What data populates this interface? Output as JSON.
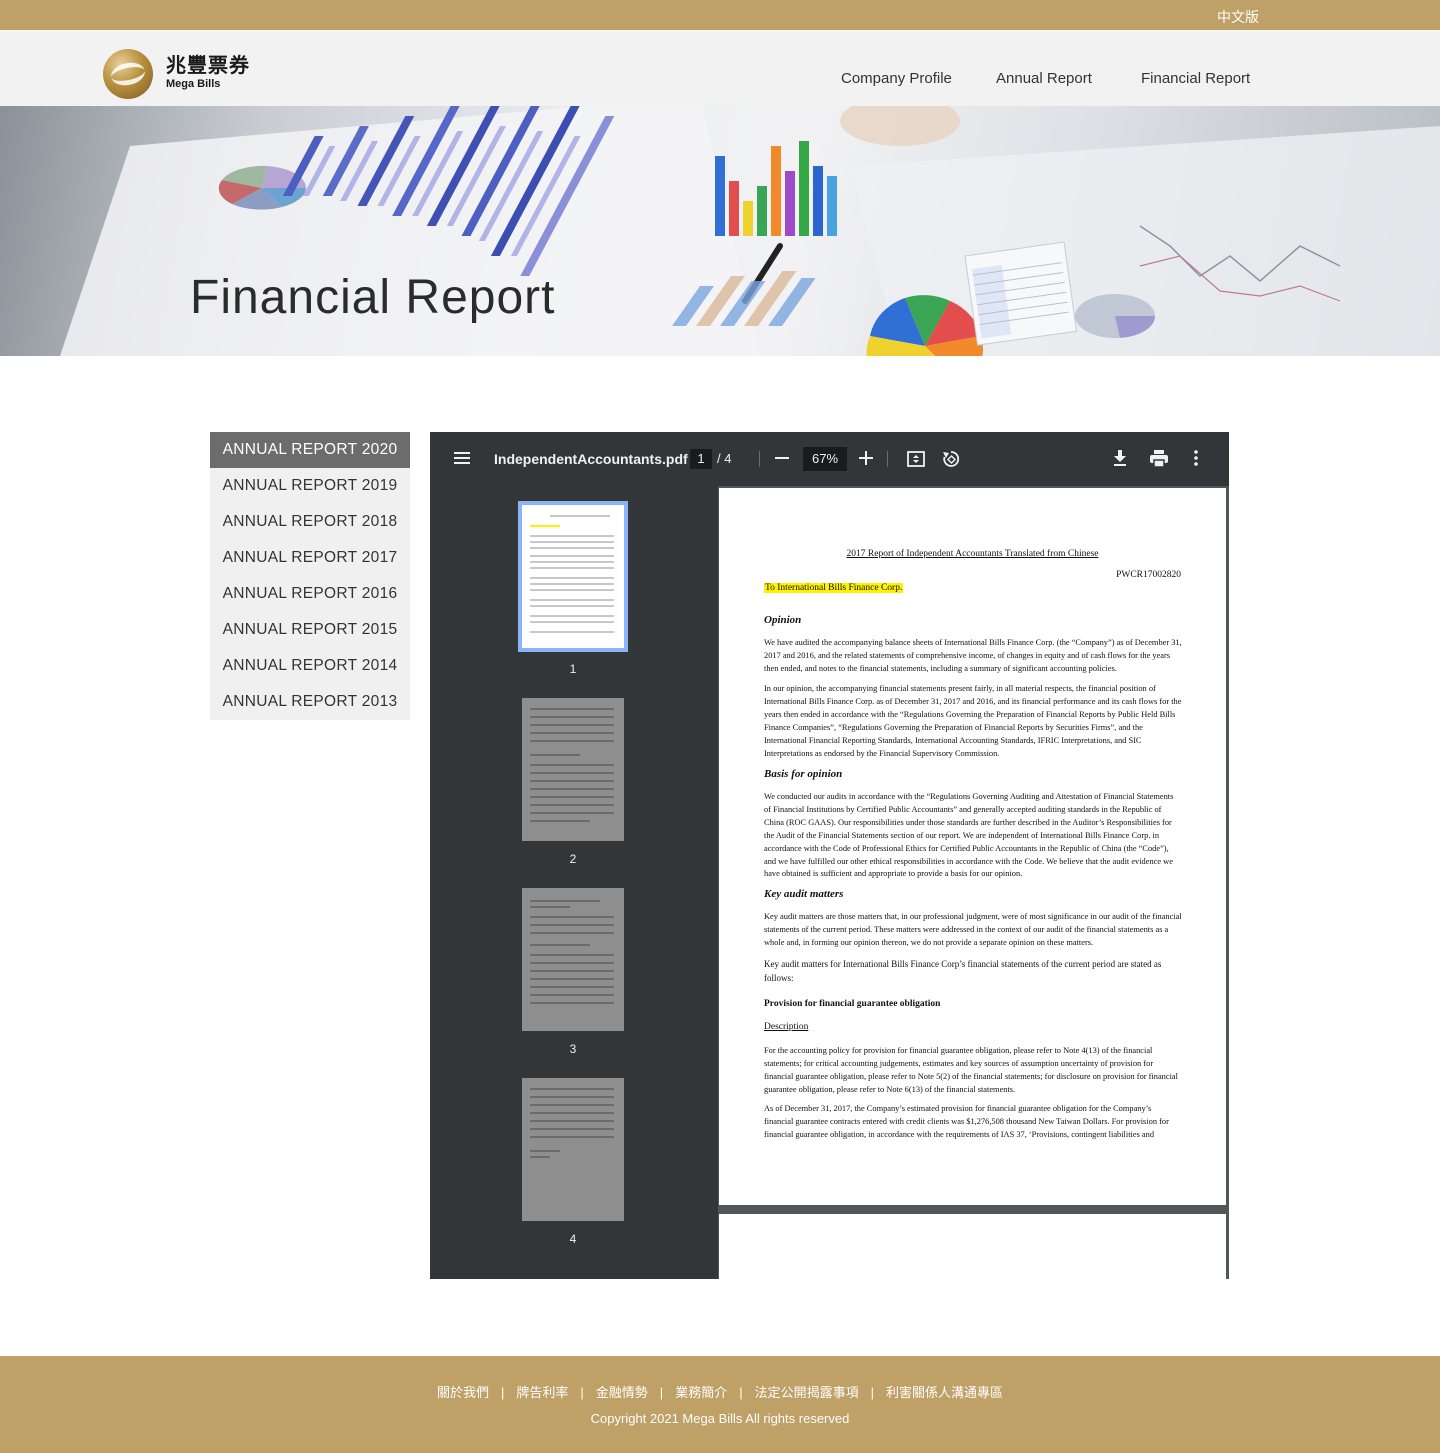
{
  "topbar": {
    "lang_label": "中文版"
  },
  "header": {
    "brand_zh": "兆豐票券",
    "brand_en": "Mega Bills",
    "nav": [
      "Company Profile",
      "Annual Report",
      "Financial Report"
    ]
  },
  "banner": {
    "title": "Financial Report"
  },
  "sidebar": {
    "items": [
      "ANNUAL REPORT 2020",
      "ANNUAL REPORT 2019",
      "ANNUAL REPORT 2018",
      "ANNUAL REPORT 2017",
      "ANNUAL REPORT 2016",
      "ANNUAL REPORT 2015",
      "ANNUAL REPORT 2014",
      "ANNUAL REPORT 2013"
    ],
    "active_index": 0
  },
  "pdf_viewer": {
    "filename": "IndependentAccountants.pdf",
    "current_page": "1",
    "total_pages": "/  4",
    "zoom": "67%",
    "thumbnails": [
      "1",
      "2",
      "3",
      "4"
    ],
    "page": {
      "title": "2017 Report of Independent Accountants Translated from Chinese",
      "ref": "PWCR17002820",
      "to": "To International Bills Finance Corp.",
      "h_opinion": "Opinion",
      "opinion_p1": "We have audited the accompanying balance sheets of International Bills Finance Corp. (the “Company”) as of December 31, 2017 and 2016, and the related statements of comprehensive income, of changes in equity and of cash flows for the years then ended, and notes to the financial statements, including a summary of significant accounting policies.",
      "opinion_p2": "In our opinion, the accompanying financial statements present fairly, in all material respects, the financial position of International Bills Finance Corp. as of December 31, 2017 and 2016, and its financial performance and its cash flows for the years then ended in accordance with the “Regulations Governing the Preparation of Financial Reports by Public Held Bills Finance Companies”, “Regulations Governing the Preparation of Financial Reports by Securities Firms”, and the International Financial Reporting Standards, International Accounting Standards, IFRIC Interpretations, and SIC Interpretations as endorsed by the Financial Supervisory Commission.",
      "h_basis": "Basis for opinion",
      "basis_p1": "We conducted our audits in accordance with the “Regulations Governing Auditing and Attestation of Financial Statements of Financial Institutions by Certified Public Accountants” and generally accepted auditing standards in the Republic of China (ROC GAAS). Our responsibilities under those standards are further described in the Auditor’s Responsibilities for the Audit of the Financial Statements section of our report. We are independent of International Bills Finance Corp. in accordance with the Code of Professional Ethics for Certified Public Accountants in the Republic of China (the “Code”), and we have fulfilled our other ethical responsibilities in accordance with the Code. We believe that the audit evidence we have obtained is sufficient and appropriate to provide a basis for our opinion.",
      "h_key": "Key audit matters",
      "key_p1": "Key audit matters are those matters that, in our professional judgment, were of most significance in our audit of the financial statements of the current period. These matters were addressed in the context of our audit of the financial statements as a whole and, in forming our opinion thereon, we do not provide a separate opinion on these matters.",
      "key_p2": "Key audit matters for International Bills Finance Corp’s financial statements of the current period are stated as follows:",
      "sub_provision": "Provision for financial guarantee obligation",
      "desc_label": "Description",
      "desc_p1": "For the accounting policy for provision for financial guarantee obligation, please refer to Note 4(13) of the financial statements; for critical accounting judgements, estimates and key sources of assumption uncertainty of provision for financial guarantee obligation, please refer to Note 5(2) of the financial statements; for disclosure on provision for financial guarantee obligation, please refer to Note 6(13) of the financial statements.",
      "desc_p2": "As of December 31, 2017, the Company’s estimated provision for financial guarantee obligation for the Company’s financial guarantee contracts entered with credit clients was $1,276,508 thousand New Taiwan Dollars. For provision for financial guarantee obligation, in accordance with the requirements of IAS 37, ‘Provisions, contingent liabilities and"
    }
  },
  "footer": {
    "links": [
      "關於我們",
      "牌告利率",
      "金融情勢",
      "業務簡介",
      "法定公開揭露事項",
      "利害關係人溝通專區"
    ],
    "separator": "|",
    "copyright": "Copyright 2021 Mega Bills All rights reserved"
  },
  "colors": {
    "gold": "#bfa066",
    "toolbar": "#323639",
    "active_side": "#6c6c6c",
    "highlight": "#fff200"
  },
  "icons": [
    "menu-icon",
    "minus-icon",
    "plus-icon",
    "fit-page-icon",
    "rotate-icon",
    "download-icon",
    "print-icon",
    "more-vert-icon"
  ]
}
